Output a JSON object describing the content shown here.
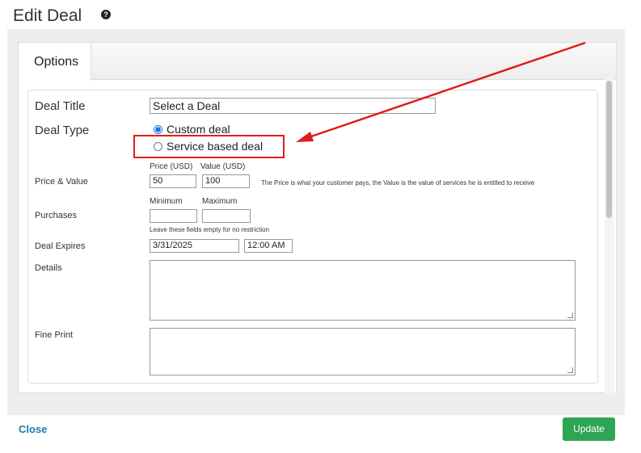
{
  "header": {
    "title": "Edit Deal",
    "help_icon": "question-circle-icon"
  },
  "tabs": [
    {
      "label": "Options",
      "active": true
    }
  ],
  "form": {
    "deal_title": {
      "label": "Deal Title",
      "value": "Select a Deal"
    },
    "deal_type": {
      "label": "Deal Type",
      "options": [
        {
          "label": "Custom deal",
          "selected": true
        },
        {
          "label": "Service based deal",
          "selected": false
        }
      ]
    },
    "price_value": {
      "label": "Price & Value",
      "price_header": "Price (USD)",
      "value_header": "Value (USD)",
      "price": "50",
      "value": "100",
      "hint": "The Price is what your customer pays, the Value is the value of services he is entitled to receive"
    },
    "purchases": {
      "label": "Purchases",
      "min_header": "Minimum",
      "max_header": "Maximum",
      "min": "",
      "max": "",
      "hint": "Leave these fields empty for no restriction"
    },
    "deal_expires": {
      "label": "Deal Expires",
      "date": "3/31/2025",
      "time": "12:00 AM"
    },
    "details": {
      "label": "Details",
      "value": ""
    },
    "fine_print": {
      "label": "Fine Print",
      "value": ""
    }
  },
  "footer": {
    "close_label": "Close",
    "update_label": "Update"
  },
  "annotation": {
    "color": "#e21b1b",
    "target": "Service based deal"
  },
  "colors": {
    "update_button": "#2ea552",
    "close_link": "#1a7ab0",
    "radio_selected": "#1a73e8"
  }
}
